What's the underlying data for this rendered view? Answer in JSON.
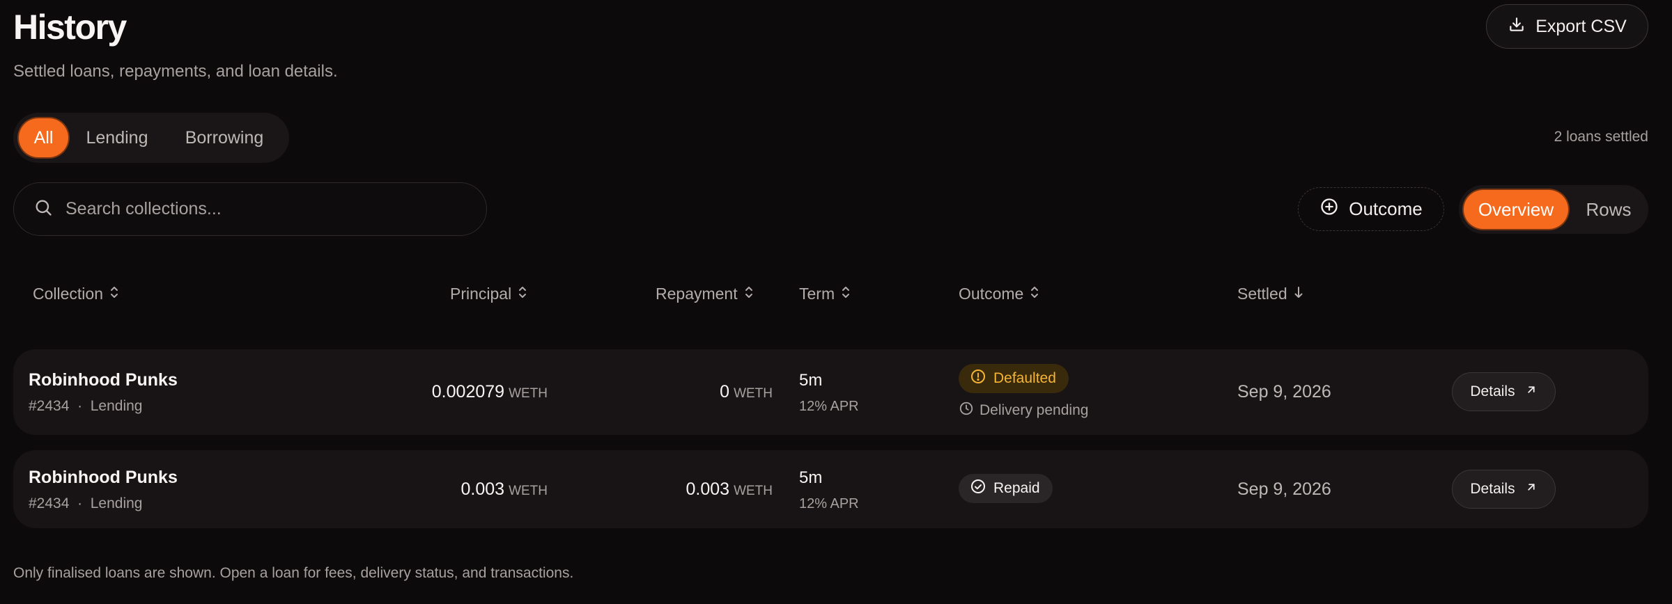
{
  "header": {
    "title": "History",
    "subtitle": "Settled loans, repayments, and loan details.",
    "export_label": "Export CSV"
  },
  "scope_tabs": [
    "All",
    "Lending",
    "Borrowing"
  ],
  "active_scope": "All",
  "loan_count": "2 loans settled",
  "search": {
    "placeholder": "Search collections..."
  },
  "outcome_filter_label": "Outcome",
  "view_toggle": [
    "Overview",
    "Rows"
  ],
  "active_view": "Overview",
  "columns": {
    "collection": "Collection",
    "principal": "Principal",
    "repayment": "Repayment",
    "term": "Term",
    "outcome": "Outcome",
    "settled": "Settled"
  },
  "loans": [
    {
      "collection": "Robinhood Punks",
      "token": "#2434",
      "side": "Lending",
      "principal": "0.002079",
      "principal_unit": "WETH",
      "repayment": "0",
      "repayment_unit": "WETH",
      "term": "5m",
      "apr": "12% APR",
      "outcome": "Defaulted",
      "outcome_note": "Delivery pending",
      "settled": "Sep 9, 2026",
      "action": "Details"
    },
    {
      "collection": "Robinhood Punks",
      "token": "#2434",
      "side": "Lending",
      "principal": "0.003",
      "principal_unit": "WETH",
      "repayment": "0.003",
      "repayment_unit": "WETH",
      "term": "5m",
      "apr": "12% APR",
      "outcome": "Repaid",
      "settled": "Sep 9, 2026",
      "action": "Details"
    }
  ],
  "separator": "·",
  "footer_note": "Only finalised loans are shown. Open a loan for fees, delivery status, and transactions.",
  "colors": {
    "accent": "#f56a1c",
    "defaulted": "#f5b436",
    "background": "#0d0a0b"
  }
}
